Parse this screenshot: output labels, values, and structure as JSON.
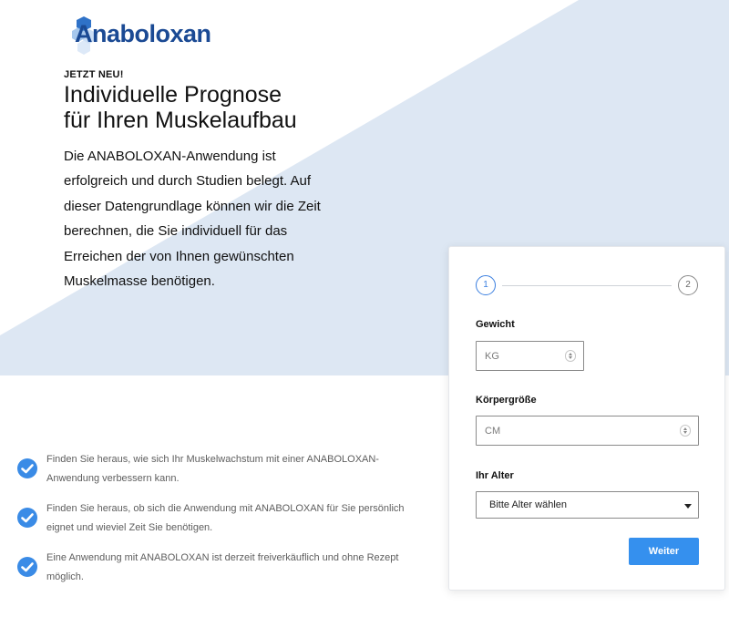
{
  "brand": {
    "name": "Anaboloxan",
    "accent_color": "#1b4a94",
    "logo_mark": "hexagon-cluster"
  },
  "hero": {
    "eyebrow": "JETZT NEU!",
    "headline_line1": "Individuelle Prognose",
    "headline_line2": "für Ihren Muskelaufbau",
    "intro_lines": [
      "Die ANABOLOXAN-Anwendung ist",
      "erfolgreich und durch Studien belegt. Auf",
      "dieser Datengrundlage können wir die Zeit",
      "berechnen, die Sie individuell für das",
      "Erreichen der von Ihnen gewünschten",
      "Muskelmasse benötigen."
    ],
    "background_color": "#dde7f3"
  },
  "benefits": {
    "icon": "check-circle-icon",
    "icon_color": "#3a8be6",
    "items": [
      {
        "line1": "Finden Sie heraus, wie sich Ihr Muskelwachstum mit einer ANABOLOXAN-",
        "line2": "Anwendung verbessern kann."
      },
      {
        "line1": "Finden Sie heraus, ob sich die Anwendung mit ANABOLOXAN für Sie persönlich",
        "line2": "eignet und wieviel Zeit Sie benötigen."
      },
      {
        "line1": "Eine Anwendung mit ANABOLOXAN ist derzeit freiverkäuflich und ohne Rezept",
        "line2": "möglich."
      }
    ]
  },
  "form": {
    "steps": [
      "1",
      "2"
    ],
    "active_step": 1,
    "weight": {
      "label": "Gewicht",
      "placeholder": "KG"
    },
    "height": {
      "label": "Körpergröße",
      "placeholder": "CM"
    },
    "age": {
      "label": "Ihr Alter",
      "selected": "Bitte Alter wählen"
    },
    "submit_label": "Weiter",
    "submit_color": "#3590ee"
  }
}
